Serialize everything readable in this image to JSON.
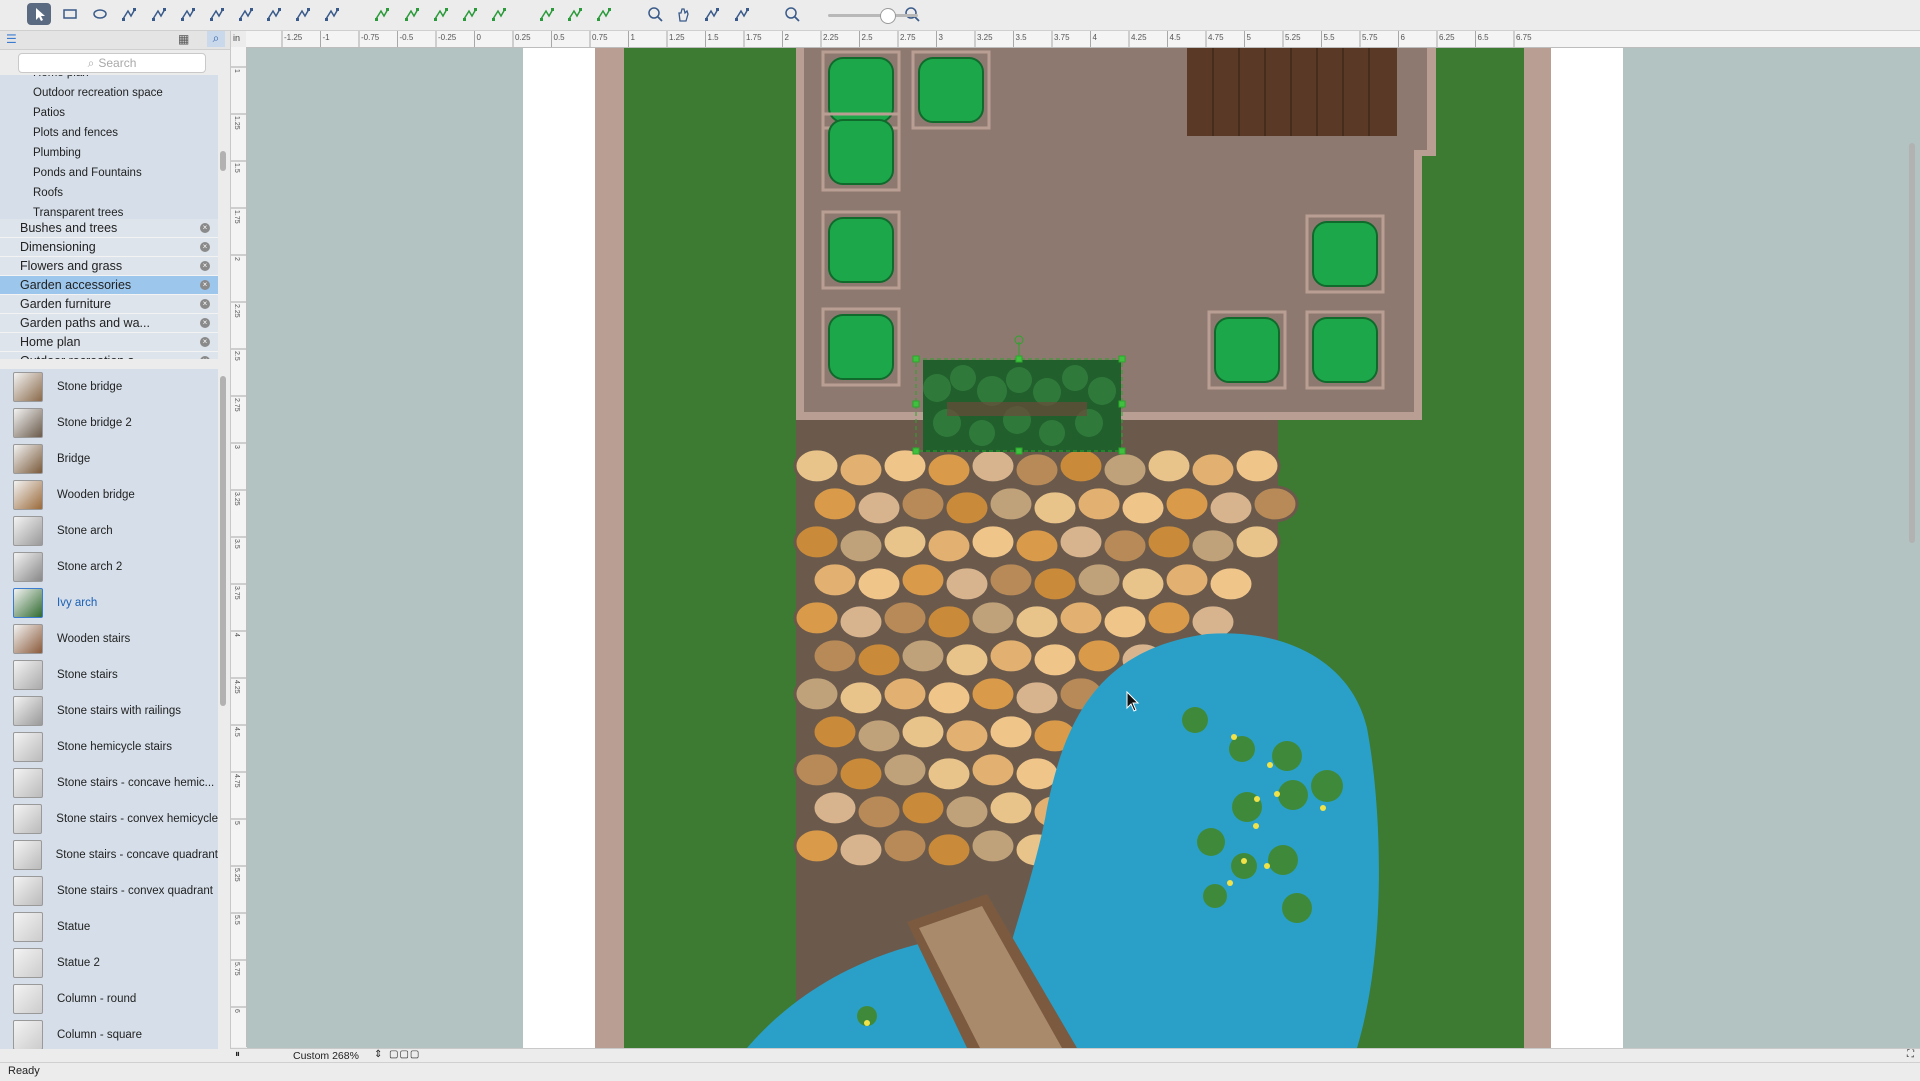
{
  "colors": {
    "grass": "#3d7a32",
    "patio": "#8e7970",
    "patio_border": "#b99f93",
    "path": "#6b5a4c",
    "pond": "#2aa0c8",
    "deck": "#5a3a26",
    "bush": "#1ca84a",
    "selection": "#2ba52b"
  },
  "toolbar": {
    "tools": [
      "pointer-icon",
      "rectangle-icon",
      "ellipse-icon",
      "text-block-icon",
      "connector-icon",
      "arc-connector-icon",
      "tree-connector-icon",
      "orthogonal-connector-icon",
      "rounded-connector-icon",
      "smart-connector-icon",
      "insert-icon",
      "line-icon",
      "arc-icon",
      "bezier-icon",
      "polyline-icon",
      "freehand-icon",
      "group-icon",
      "snap-icon",
      "arrange-icon",
      "zoom-icon",
      "hand-icon",
      "stamp-icon",
      "eyedropper-icon",
      "zoom-out-icon",
      "zoom-in-icon"
    ]
  },
  "library": {
    "search_placeholder": "Search",
    "subcategories": [
      "Home plan",
      "Outdoor recreation space",
      "Patios",
      "Plots and fences",
      "Plumbing",
      "Ponds and Fountains",
      "Roofs",
      "Transparent trees"
    ],
    "categories": [
      {
        "label": "Bushes and trees",
        "selected": false
      },
      {
        "label": "Dimensioning",
        "selected": false
      },
      {
        "label": "Flowers and grass",
        "selected": false
      },
      {
        "label": "Garden accessories",
        "selected": true
      },
      {
        "label": "Garden furniture",
        "selected": false
      },
      {
        "label": "Garden paths and wa...",
        "selected": false
      },
      {
        "label": "Home plan",
        "selected": false
      },
      {
        "label": "Outdoor recreation s...",
        "selected": false
      }
    ],
    "shapes": [
      {
        "label": "Stone bridge",
        "selected": false
      },
      {
        "label": "Stone bridge 2",
        "selected": false
      },
      {
        "label": "Bridge",
        "selected": false
      },
      {
        "label": "Wooden bridge",
        "selected": false
      },
      {
        "label": "Stone arch",
        "selected": false
      },
      {
        "label": "Stone arch 2",
        "selected": false
      },
      {
        "label": "Ivy arch",
        "selected": true
      },
      {
        "label": "Wooden stairs",
        "selected": false
      },
      {
        "label": "Stone stairs",
        "selected": false
      },
      {
        "label": "Stone stairs with railings",
        "selected": false
      },
      {
        "label": "Stone hemicycle stairs",
        "selected": false
      },
      {
        "label": "Stone stairs - concave hemic...",
        "selected": false
      },
      {
        "label": "Stone stairs - convex hemicycle",
        "selected": false
      },
      {
        "label": "Stone stairs - concave quadrant",
        "selected": false
      },
      {
        "label": "Stone stairs - convex quadrant",
        "selected": false
      },
      {
        "label": "Statue",
        "selected": false
      },
      {
        "label": "Statue 2",
        "selected": false
      },
      {
        "label": "Column - round",
        "selected": false
      },
      {
        "label": "Column - square",
        "selected": false
      }
    ]
  },
  "ruler": {
    "unit": "in",
    "h_labels": [
      "-1.25",
      "-1",
      "-0.75",
      "-0.5",
      "-0.25",
      "0",
      "0.25",
      "0.5",
      "0.75",
      "1",
      "1.25",
      "1.5",
      "1.75",
      "2",
      "2.25",
      "2.5",
      "2.75",
      "3",
      "3.25",
      "3.5",
      "3.75",
      "4",
      "4.25",
      "4.5",
      "4.75",
      "5",
      "5.25",
      "5.5",
      "5.75",
      "6",
      "6.25",
      "6.5",
      "6.75"
    ],
    "v_labels": [
      "1",
      "1.25",
      "1.5",
      "1.75",
      "2",
      "2.25",
      "2.5",
      "2.75",
      "3",
      "3.25",
      "3.5",
      "3.75",
      "4",
      "4.25",
      "4.5",
      "4.75",
      "5",
      "5.25",
      "5.5",
      "5.75",
      "6"
    ]
  },
  "zoom": {
    "label": "Custom 268%"
  },
  "status": {
    "text": "Ready"
  }
}
